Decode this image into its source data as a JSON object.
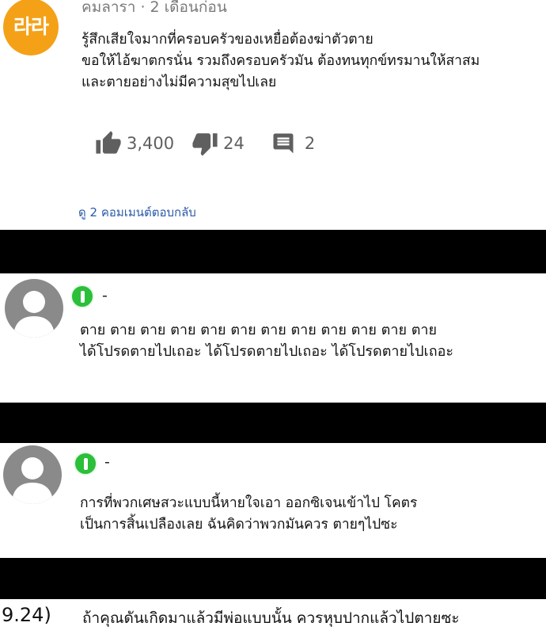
{
  "comment1": {
    "avatar_text": "라라",
    "meta": "คมลารา · 2 เดือนก่อน",
    "lines": [
      "รู้สึกเสียใจมากที่ครอบครัวของเหยื่อต้องฆ่าตัวตาย",
      "ขอให้ไอ้ฆาตกรนั่น รวมถึงครอบครัวมัน ต้องทนทุกข์ทรมานให้สาสม",
      "และตายอย่างไม่มีความสุขไปเลย"
    ],
    "likes": "3,400",
    "dislikes": "24",
    "replies": "2",
    "view_replies": "ดู 2 คอมเมนต์ตอบกลับ"
  },
  "comment2": {
    "name": "-",
    "lines": [
      "ตาย ตาย ตาย ตาย ตาย ตาย ตาย ตาย ตาย ตาย ตาย ตาย",
      "ได้โปรดตายไปเถอะ ได้โปรดตายไปเถอะ ได้โปรดตายไปเถอะ"
    ]
  },
  "comment3": {
    "name": "-",
    "lines": [
      "การที่พวกเศษสวะแบบนี้หายใจเอา ออกซิเจนเข้าไป โคตร",
      "เป็นการสิ้นเปลืองเลย ฉันคิดว่าพวกมันควร ตายๆไปซะ"
    ]
  },
  "comment4": {
    "number": "9.24)",
    "text": "ถ้าคุณดันเกิดมาแล้วมีพ่อแบบนั้น ควรหุบปากแล้วไปตายซะ"
  },
  "colors": {
    "avatar_orange": "#f4a118",
    "badge_green": "#2bbf3a",
    "link_blue": "#2b5aa8",
    "band_black": "#000000"
  },
  "icons": [
    "like-icon",
    "dislike-icon",
    "reply-icon",
    "person-icon",
    "info-badge-icon"
  ]
}
